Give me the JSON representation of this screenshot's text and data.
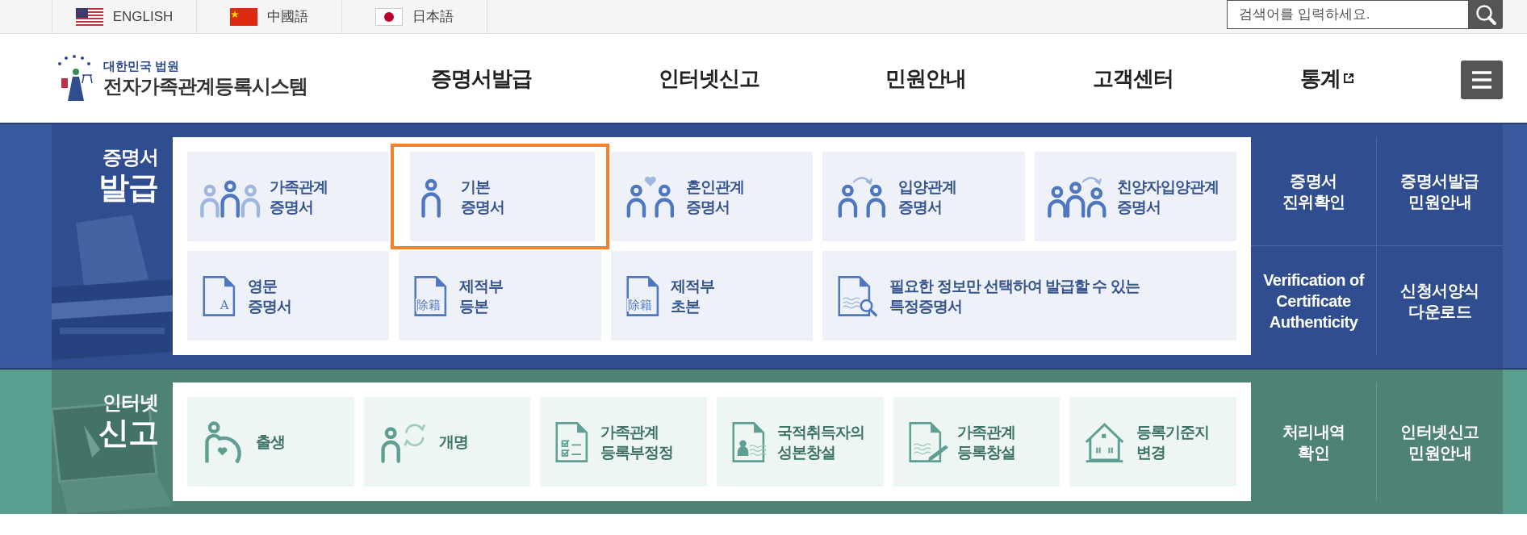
{
  "language_links": [
    {
      "label": "ENGLISH",
      "kind": "us"
    },
    {
      "label": "中國語",
      "kind": "cn"
    },
    {
      "label": "日本語",
      "kind": "jp"
    }
  ],
  "search": {
    "placeholder": "검색어를 입력하세요."
  },
  "logo": {
    "subtitle": "대한민국 법원",
    "title": "전자가족관계등록시스템"
  },
  "nav": [
    {
      "label": "증명서발급",
      "external": false
    },
    {
      "label": "인터넷신고",
      "external": false
    },
    {
      "label": "민원안내",
      "external": false
    },
    {
      "label": "고객센터",
      "external": false
    },
    {
      "label": "통계",
      "external": true
    }
  ],
  "sections": [
    {
      "kind": "certificate",
      "title_top": "증명서",
      "title_bottom": "발급",
      "tiles": [
        {
          "lines": [
            "가족관계",
            "증명서"
          ],
          "kind": "family",
          "wide": false,
          "highlighted": false
        },
        {
          "lines": [
            "기본",
            "증명서"
          ],
          "kind": "person",
          "wide": false,
          "highlighted": true
        },
        {
          "lines": [
            "혼인관계",
            "증명서"
          ],
          "kind": "marriage",
          "wide": false,
          "highlighted": false
        },
        {
          "lines": [
            "입양관계",
            "증명서"
          ],
          "kind": "adoption",
          "wide": false,
          "highlighted": false
        },
        {
          "lines": [
            "친양자입양관계",
            "증명서"
          ],
          "kind": "parent-adoption",
          "wide": false,
          "highlighted": false
        },
        {
          "lines": [
            "영문",
            "증명서"
          ],
          "kind": "letter-doc",
          "icon_text": "A",
          "wide": false,
          "highlighted": false
        },
        {
          "lines": [
            "제적부",
            "등본"
          ],
          "kind": "letter-doc",
          "icon_text": "除籍",
          "wide": false,
          "highlighted": false
        },
        {
          "lines": [
            "제적부",
            "초본"
          ],
          "kind": "letter-doc",
          "icon_text": "除籍",
          "wide": false,
          "highlighted": false
        },
        {
          "lines": [
            "필요한 정보만 선택하여 발급할 수 있는",
            "특정증명서"
          ],
          "kind": "search-doc",
          "wide": true,
          "highlighted": false
        }
      ],
      "side_links": [
        {
          "lines": [
            "증명서",
            "진위확인"
          ]
        },
        {
          "lines": [
            "증명서발급",
            "민원안내"
          ]
        },
        {
          "lines": [
            "Verification of",
            "Certificate",
            "Authenticity"
          ]
        },
        {
          "lines": [
            "신청서양식",
            "다운로드"
          ]
        }
      ]
    },
    {
      "kind": "report",
      "title_top": "인터넷",
      "title_bottom": "신고",
      "tiles": [
        {
          "lines": [
            "출생"
          ],
          "kind": "birth",
          "highlighted": false
        },
        {
          "lines": [
            "개명"
          ],
          "kind": "rename",
          "highlighted": false
        },
        {
          "lines": [
            "가족관계",
            "등록부정정"
          ],
          "kind": "checklist-doc",
          "highlighted": false
        },
        {
          "lines": [
            "국적취득자의",
            "성본창설"
          ],
          "kind": "id-doc",
          "highlighted": false
        },
        {
          "lines": [
            "가족관계",
            "등록창설"
          ],
          "kind": "edit-doc",
          "highlighted": false
        },
        {
          "lines": [
            "등록기준지",
            "변경"
          ],
          "kind": "house",
          "highlighted": false
        }
      ],
      "side_links": [
        {
          "lines": [
            "처리내역",
            "확인"
          ]
        },
        {
          "lines": [
            "인터넷신고",
            "민원안내"
          ]
        }
      ]
    }
  ]
}
